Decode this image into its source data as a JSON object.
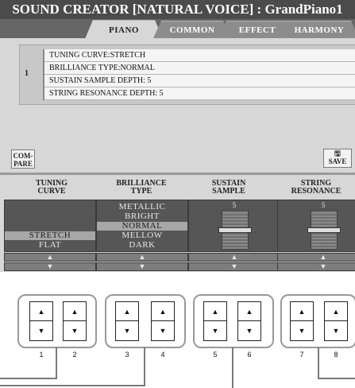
{
  "title": "SOUND CREATOR [NATURAL VOICE] : GrandPiano1",
  "tabs": [
    {
      "label": "PIANO",
      "active": true
    },
    {
      "label": "COMMON",
      "active": false
    },
    {
      "label": "EFFECT",
      "active": false
    },
    {
      "label": "HARMONY",
      "active": false
    }
  ],
  "info": {
    "number": "1",
    "rows": [
      "TUNING CURVE:STRETCH",
      "BRILLIANCE TYPE:NORMAL",
      "SUSTAIN SAMPLE DEPTH: 5",
      "STRING RESONANCE DEPTH: 5"
    ]
  },
  "buttons": {
    "compare_line1": "COM-",
    "compare_line2": "PARE",
    "save_label": "SAVE",
    "save_icon": "save-icon"
  },
  "params": {
    "tuning": {
      "label_line1": "TUNING",
      "label_line2": "CURVE",
      "options": [
        "STRETCH",
        "FLAT"
      ],
      "selected": "STRETCH"
    },
    "brilliance": {
      "label_line1": "BRILLIANCE",
      "label_line2": "TYPE",
      "options": [
        "METALLIC",
        "BRIGHT",
        "NORMAL",
        "MELLOW",
        "DARK"
      ],
      "selected": "NORMAL"
    },
    "sustain": {
      "label_line1": "SUSTAIN",
      "label_line2": "SAMPLE",
      "value": "5"
    },
    "resonance": {
      "label_line1": "STRING",
      "label_line2": "RESONANCE",
      "value": "5"
    }
  },
  "arrows": {
    "up": "▲",
    "down": "▼"
  },
  "hardware_buttons": [
    "1",
    "2",
    "3",
    "4",
    "5",
    "6",
    "7",
    "8"
  ],
  "colors": {
    "title_bg": "#4b4b4b",
    "screen_bg": "#d7d7d7",
    "selected_item": "#a7a7a7",
    "list_bg": "#565656"
  }
}
